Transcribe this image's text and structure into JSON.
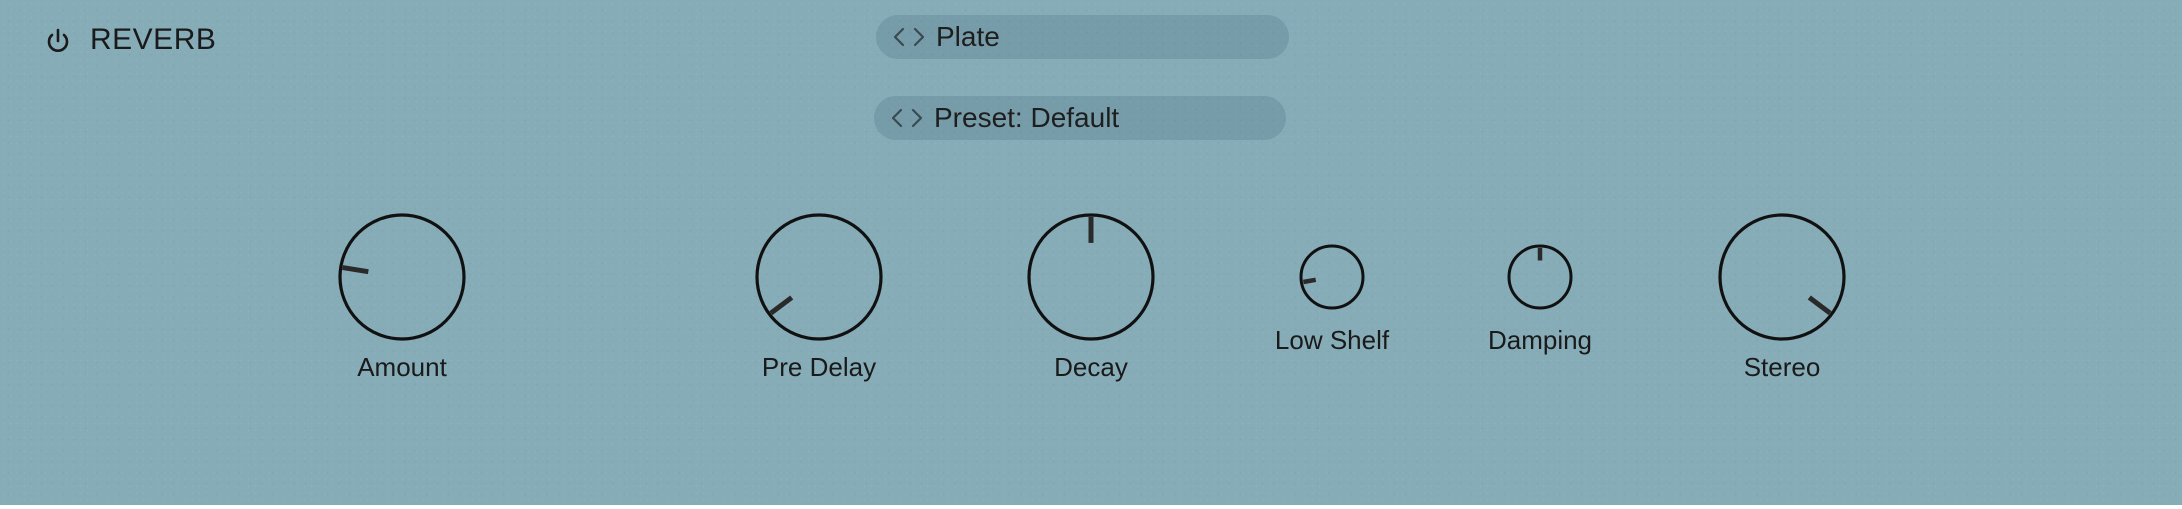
{
  "header": {
    "title": "REVERB",
    "power_icon": "power-icon"
  },
  "algorithm_selector": {
    "value": "Plate",
    "icons": [
      "chevron-left-icon",
      "chevron-right-icon"
    ]
  },
  "preset_selector": {
    "value": "Preset: Default",
    "icons": [
      "chevron-left-icon",
      "chevron-right-icon"
    ]
  },
  "knobs": {
    "amount": {
      "label": "Amount",
      "level": 0.2
    },
    "pre_delay": {
      "label": "Pre Delay",
      "level": 0.03
    },
    "decay": {
      "label": "Decay",
      "level": 0.5
    },
    "low_shelf": {
      "label": "Low Shelf",
      "level": 0.13
    },
    "damping": {
      "label": "Damping",
      "level": 0.5
    },
    "stereo": {
      "label": "Stereo",
      "level": 0.97
    }
  },
  "colors": {
    "background": "#86acb8",
    "ink": "#1a1a1a",
    "selector_bg": "rgba(60,100,115,0.22)"
  }
}
